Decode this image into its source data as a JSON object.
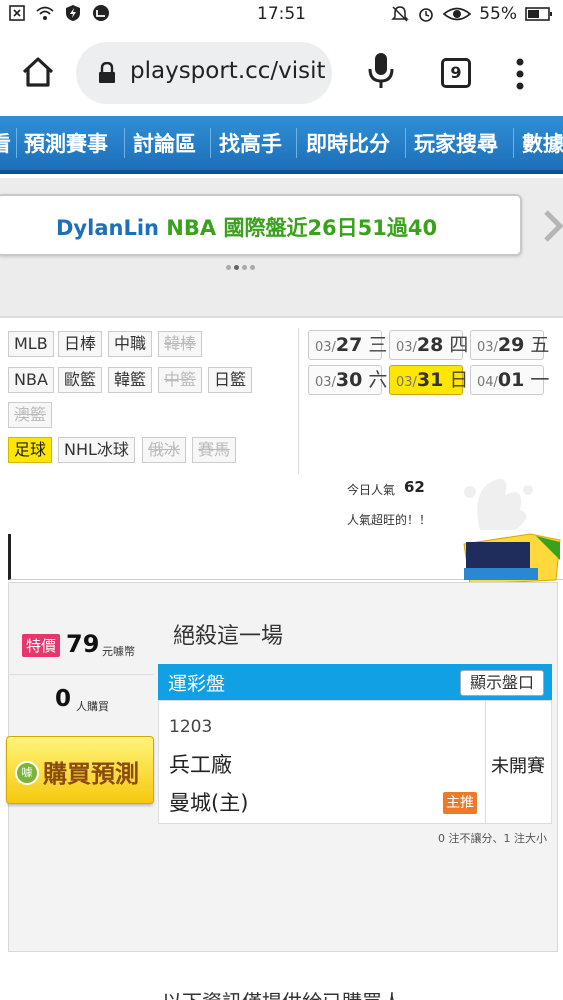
{
  "status_bar": {
    "time": "17:51",
    "battery": "55%"
  },
  "browser": {
    "url": "playsport.cc/visit",
    "tab_count": "9"
  },
  "nav": {
    "items": [
      "看",
      "預測賽事",
      "討論區",
      "找高手",
      "即時比分",
      "玩家搜尋",
      "數據"
    ]
  },
  "banner": {
    "user": "DylanLin",
    "info": "NBA 國際盤近26日51過40"
  },
  "sports": [
    {
      "label": "MLB",
      "state": "normal"
    },
    {
      "label": "日棒",
      "state": "normal"
    },
    {
      "label": "中職",
      "state": "normal"
    },
    {
      "label": "韓棒",
      "state": "disabled"
    },
    {
      "label": "NBA",
      "state": "normal"
    },
    {
      "label": "歐籃",
      "state": "normal"
    },
    {
      "label": "韓籃",
      "state": "normal"
    },
    {
      "label": "中籃",
      "state": "disabled"
    },
    {
      "label": "日籃",
      "state": "normal"
    },
    {
      "label": "澳籃",
      "state": "disabled"
    },
    {
      "label": "足球",
      "state": "active"
    },
    {
      "label": "NHL冰球",
      "state": "normal"
    },
    {
      "label": "俄冰",
      "state": "disabled"
    },
    {
      "label": "賽馬",
      "state": "disabled"
    }
  ],
  "dates": [
    {
      "month": "03/",
      "day": "27",
      "weekday": "三",
      "active": false
    },
    {
      "month": "03/",
      "day": "28",
      "weekday": "四",
      "active": false
    },
    {
      "month": "03/",
      "day": "29",
      "weekday": "五",
      "active": false
    },
    {
      "month": "03/",
      "day": "30",
      "weekday": "六",
      "active": false
    },
    {
      "month": "03/",
      "day": "31",
      "weekday": "日",
      "active": true
    },
    {
      "month": "04/",
      "day": "01",
      "weekday": "一",
      "active": false
    }
  ],
  "popularity": {
    "label": "今日人氣",
    "value": "62",
    "note": "人氣超旺的！！"
  },
  "product": {
    "price_tag": "特價",
    "price": "79",
    "price_unit": "元噱幣",
    "buyers": "0",
    "buyers_unit": "人購買",
    "buy_label": "購買預測",
    "title": "絕殺這一場",
    "market": "運彩盤",
    "show_odds": "顯示盤口",
    "game_no": "1203",
    "away_team": "兵工廠",
    "home_team": "曼城(主)",
    "pick_badge": "主推",
    "game_status": "未開賽",
    "stats_note": "0 注不讓分、1 注大小"
  },
  "footer": {
    "note": "以下資訊僅提供給已購買人"
  },
  "colors": {
    "nav_blue": "#1d6fb8",
    "active_yellow": "#ffe600",
    "market_blue": "#12a0e4",
    "price_pink": "#e7366e"
  }
}
